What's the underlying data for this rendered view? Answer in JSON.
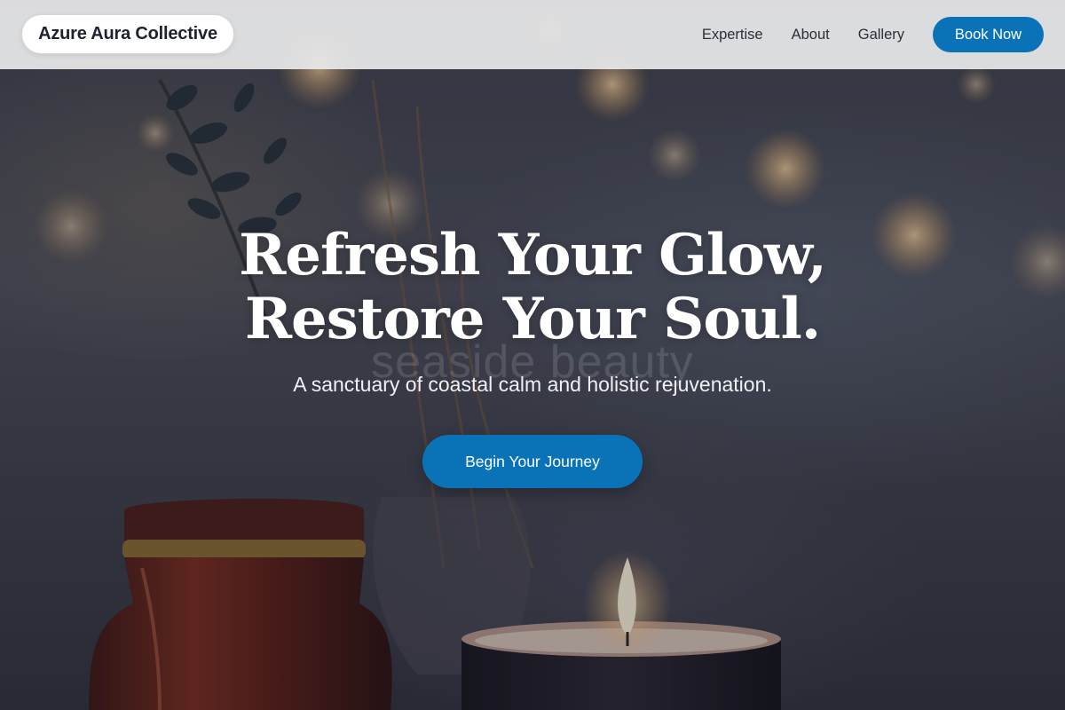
{
  "brand": {
    "name": "Azure Aura Collective"
  },
  "nav": {
    "links": [
      "Expertise",
      "About",
      "Gallery"
    ],
    "cta_label": "Book Now"
  },
  "hero": {
    "headline_line1": "Refresh Your Glow,",
    "headline_line2": "Restore Your Soul.",
    "watermark_text": "seaside beauty",
    "subtitle": "A sanctuary of coastal calm and holistic rejuvenation.",
    "cta_label": "Begin Your Journey",
    "background_image": "candle-and-amber-jar-with-bokeh-lights-photo"
  },
  "colors": {
    "accent": "#0a73b7",
    "navbar_bg": "#e8e8ea",
    "hero_text": "#ffffff"
  }
}
